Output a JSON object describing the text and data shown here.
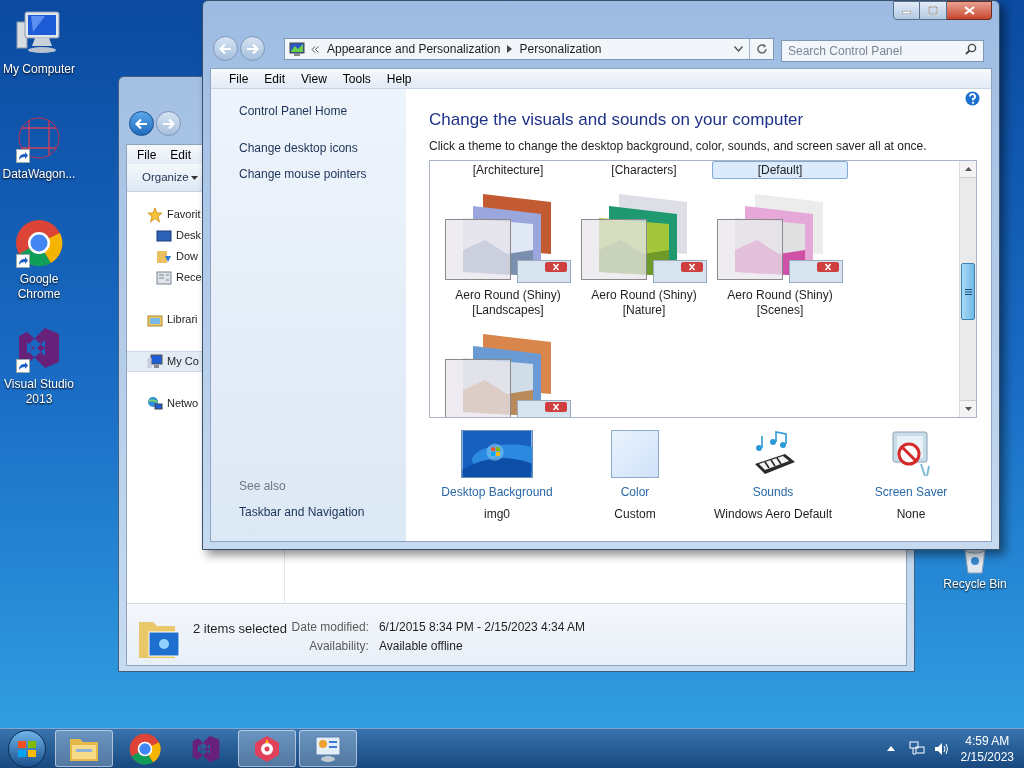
{
  "desktop_icons": [
    {
      "kind": "computer",
      "label": "My Computer",
      "shortcut": false
    },
    {
      "kind": "mesh",
      "label": "DataWagon...",
      "shortcut": true
    },
    {
      "kind": "chrome",
      "label": "Google Chrome",
      "shortcut": true
    },
    {
      "kind": "visual_studio",
      "label": "Visual Studio 2013",
      "shortcut": true
    }
  ],
  "recycle_bin": {
    "label": "Recycle Bin"
  },
  "explorer_window": {
    "menu": [
      "File",
      "Edit"
    ],
    "toolbar": [
      "Organize"
    ],
    "nav": [
      {
        "kind": "favorites",
        "label": "Favorit",
        "selected": false,
        "children": [
          {
            "kind": "desktop",
            "label": "Desk",
            "selected": false
          },
          {
            "kind": "downloads",
            "label": "Dow",
            "selected": false
          },
          {
            "kind": "recent",
            "label": "Rece",
            "selected": false
          }
        ]
      },
      {
        "kind": "libraries",
        "label": "Librari",
        "selected": false
      },
      {
        "kind": "computer",
        "label": "My Co",
        "selected": true
      },
      {
        "kind": "network",
        "label": "Netwo",
        "selected": false
      }
    ],
    "status": {
      "summary": "2 items selected",
      "fields": [
        {
          "label": "Date modified:",
          "value": "6/1/2015 8:34 PM - 2/15/2023 4:34 AM"
        },
        {
          "label": "Availability:",
          "value": "Available offline"
        }
      ]
    }
  },
  "control_panel": {
    "address": [
      "Appearance and Personalization",
      "Personalization"
    ],
    "search": {
      "placeholder": "Search Control Panel"
    },
    "menu": [
      "File",
      "Edit",
      "View",
      "Tools",
      "Help"
    ],
    "tasks": [
      "Control Panel Home",
      "Change desktop icons",
      "Change mouse pointers"
    ],
    "see_also": {
      "heading": "See also",
      "links": [
        "Taskbar and Navigation"
      ]
    },
    "heading": "Change the visuals and sounds on your computer",
    "instruction": "Click a theme to change the desktop background, color, sounds, and screen saver all at once.",
    "themes": [
      {
        "kind": "caption",
        "label": "[Architecture]",
        "selected": false
      },
      {
        "kind": "caption",
        "label": "[Characters]",
        "selected": false
      },
      {
        "kind": "caption",
        "label": "[Default]",
        "selected": true
      },
      {
        "kind": "theme",
        "label": "Aero Round (Shiny) [Landscapes]",
        "selected": false
      },
      {
        "kind": "theme",
        "label": "Aero Round (Shiny) [Nature]",
        "selected": false
      },
      {
        "kind": "theme",
        "label": "Aero Round (Shiny) [Scenes]",
        "selected": false
      },
      {
        "kind": "thumbnail",
        "selected": false
      }
    ],
    "settings": [
      {
        "kind": "background",
        "label": "Desktop Background",
        "value": "img0"
      },
      {
        "kind": "color",
        "label": "Color",
        "value": "Custom"
      },
      {
        "kind": "sounds",
        "label": "Sounds",
        "value": "Windows Aero Default"
      },
      {
        "kind": "screen_saver",
        "label": "Screen Saver",
        "value": "None"
      }
    ]
  },
  "taskbar": {
    "items": [
      {
        "kind": "explorer",
        "open": true
      },
      {
        "kind": "chrome",
        "open": false
      },
      {
        "kind": "visual_studio",
        "open": false
      },
      {
        "kind": "app",
        "open": true
      },
      {
        "kind": "control_panel",
        "open": true
      }
    ],
    "time": "4:59 AM",
    "date": "2/15/2023"
  }
}
